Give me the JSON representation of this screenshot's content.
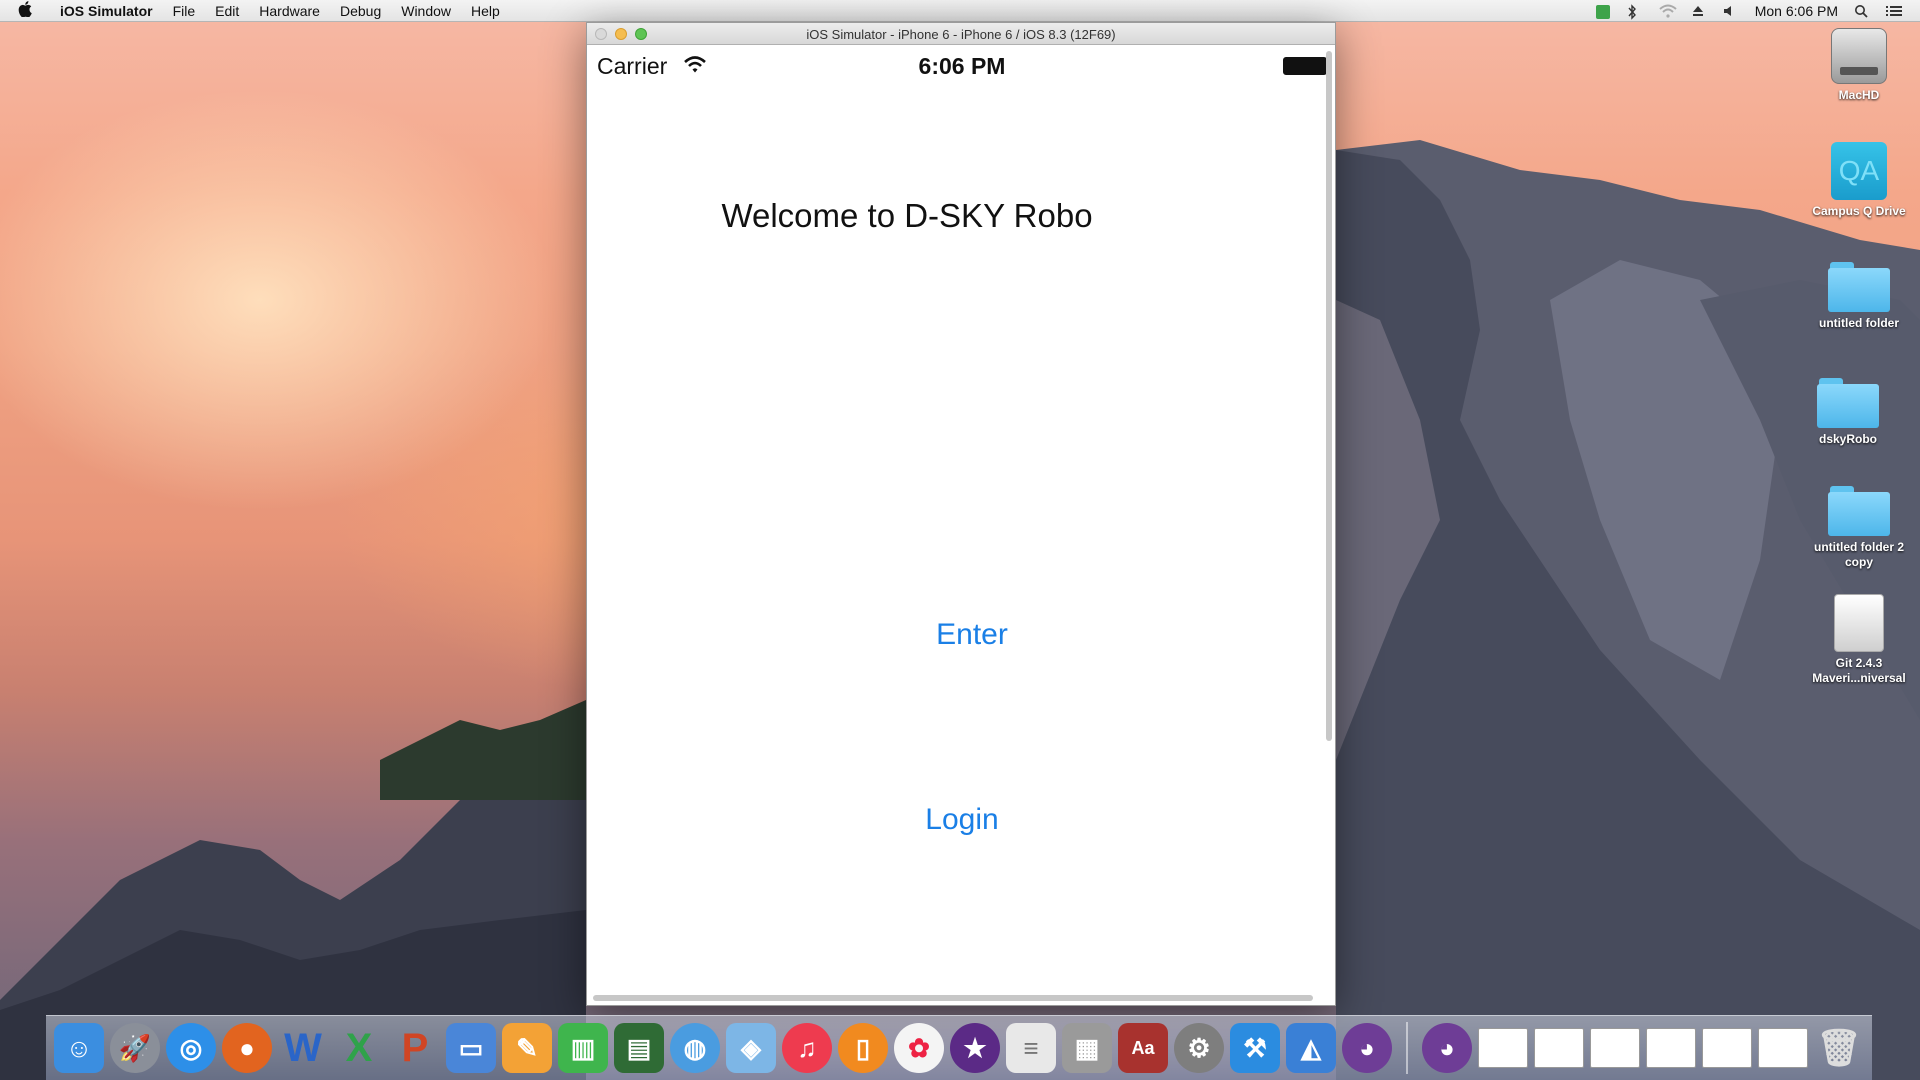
{
  "menubar": {
    "app_name": "iOS Simulator",
    "menus": [
      "File",
      "Edit",
      "Hardware",
      "Debug",
      "Window",
      "Help"
    ],
    "clock": "Mon 6:06 PM"
  },
  "simulator": {
    "window_title": "iOS Simulator - iPhone 6 - iPhone 6 / iOS 8.3 (12F69)",
    "status": {
      "carrier": "Carrier",
      "time": "6:06 PM"
    },
    "welcome": "Welcome to D-SKY Robo",
    "enter_label": "Enter",
    "login_label": "Login"
  },
  "desktop": {
    "icons": [
      {
        "label": "MacHD",
        "kind": "hard-drive"
      },
      {
        "label": "Campus Q Drive",
        "kind": "network-drive"
      },
      {
        "label": "untitled folder",
        "kind": "folder"
      },
      {
        "label": "dskyRobo",
        "kind": "folder"
      },
      {
        "label": "untitled folder 2 copy",
        "kind": "folder"
      },
      {
        "label": "Git 2.4.3 Maveri...niversal",
        "kind": "disk-image"
      }
    ]
  },
  "dock": {
    "apps": [
      "Finder",
      "Launchpad",
      "Safari",
      "Firefox",
      "Word",
      "Excel",
      "PowerPoint",
      "Keynote",
      "Pages",
      "Numbers",
      "iMovie",
      "Network",
      "Xcode Simulator",
      "iTunes",
      "iBooks",
      "Photos",
      "iMovie Star",
      "TextEdit",
      "Calculator",
      "Dictionary",
      "System Preferences",
      "Xcode",
      "Instruments",
      "GitHub",
      "GitHub 2"
    ],
    "colors": {
      "Finder": "#3b8ee0",
      "Launchpad": "#8a8f99",
      "Safari": "#2d8fe8",
      "Firefox": "#e2641f",
      "Word": "#2a65c8",
      "Excel": "#2fa24a",
      "PowerPoint": "#d04524",
      "Keynote": "#4a86d8",
      "Pages": "#f3a236",
      "Numbers": "#3fb54d",
      "iMovie": "#2f6b35",
      "Network": "#4a9ce0",
      "Xcode Simulator": "#7db6e6",
      "iTunes": "#ee3b4f",
      "iBooks": "#f18a1f",
      "Photos": "#f4f4f4",
      "iMovie Star": "#5b2a86",
      "TextEdit": "#e8e8e8",
      "Calculator": "#9a9a9a",
      "Dictionary": "#a8322e",
      "System Preferences": "#7e7e7e",
      "Xcode": "#2b8ce0",
      "Instruments": "#3a80d6",
      "GitHub": "#6e3d96",
      "GitHub 2": "#6e3d96"
    }
  },
  "accent": "#1a7fe6"
}
